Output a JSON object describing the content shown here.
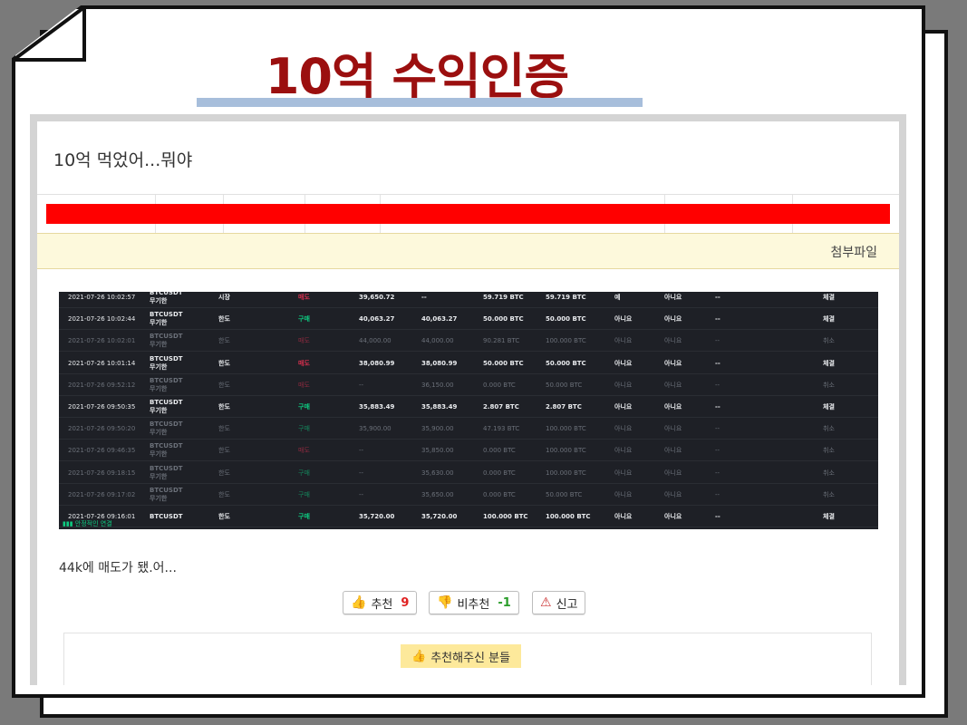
{
  "headline": {
    "text": "10억 수익인증",
    "color": "#9b0f0f",
    "underline_color": "#a7bedb"
  },
  "post": {
    "title": "10억 먹었어...뭐야",
    "redacted_bar_color": "#ff0000",
    "attachment_label": "첨부파일",
    "attachment_bar_color": "#fdf9dc",
    "body": "44k에 매도가 됐.어..."
  },
  "trade_screenshot": {
    "connection_status": "안정적인 연결",
    "rows": [
      {
        "time": "2021-07-26 10:02:57",
        "symbol": "BTCUSDT",
        "contract": "무기한",
        "type": "시장",
        "side": "매도",
        "price": "39,650.72",
        "avg": "--",
        "filled": "59.719 BTC",
        "amount": "59.719 BTC",
        "reduce": "예",
        "post": "아니요",
        "trigger": "--",
        "status": "체결",
        "active": true
      },
      {
        "time": "2021-07-26 10:02:44",
        "symbol": "BTCUSDT",
        "contract": "무기한",
        "type": "한도",
        "side": "구매",
        "price": "40,063.27",
        "avg": "40,063.27",
        "filled": "50.000 BTC",
        "amount": "50.000 BTC",
        "reduce": "아니요",
        "post": "아니요",
        "trigger": "--",
        "status": "체결",
        "active": true
      },
      {
        "time": "2021-07-26 10:02:01",
        "symbol": "BTCUSDT",
        "contract": "무기한",
        "type": "한도",
        "side": "매도",
        "price": "44,000.00",
        "avg": "44,000.00",
        "filled": "90.281 BTC",
        "amount": "100.000 BTC",
        "reduce": "아니요",
        "post": "아니요",
        "trigger": "--",
        "status": "취소",
        "active": false
      },
      {
        "time": "2021-07-26 10:01:14",
        "symbol": "BTCUSDT",
        "contract": "무기한",
        "type": "한도",
        "side": "매도",
        "price": "38,080.99",
        "avg": "38,080.99",
        "filled": "50.000 BTC",
        "amount": "50.000 BTC",
        "reduce": "아니요",
        "post": "아니요",
        "trigger": "--",
        "status": "체결",
        "active": true
      },
      {
        "time": "2021-07-26 09:52:12",
        "symbol": "BTCUSDT",
        "contract": "무기한",
        "type": "한도",
        "side": "매도",
        "price": "--",
        "avg": "36,150.00",
        "filled": "0.000 BTC",
        "amount": "50.000 BTC",
        "reduce": "아니요",
        "post": "아니요",
        "trigger": "--",
        "status": "취소",
        "active": false
      },
      {
        "time": "2021-07-26 09:50:35",
        "symbol": "BTCUSDT",
        "contract": "무기한",
        "type": "한도",
        "side": "구매",
        "price": "35,883.49",
        "avg": "35,883.49",
        "filled": "2.807 BTC",
        "amount": "2.807 BTC",
        "reduce": "아니요",
        "post": "아니요",
        "trigger": "--",
        "status": "체결",
        "active": true
      },
      {
        "time": "2021-07-26 09:50:20",
        "symbol": "BTCUSDT",
        "contract": "무기한",
        "type": "한도",
        "side": "구매",
        "price": "35,900.00",
        "avg": "35,900.00",
        "filled": "47.193 BTC",
        "amount": "100.000 BTC",
        "reduce": "아니요",
        "post": "아니요",
        "trigger": "--",
        "status": "취소",
        "active": false
      },
      {
        "time": "2021-07-26 09:46:35",
        "symbol": "BTCUSDT",
        "contract": "무기한",
        "type": "한도",
        "side": "매도",
        "price": "--",
        "avg": "35,850.00",
        "filled": "0.000 BTC",
        "amount": "100.000 BTC",
        "reduce": "아니요",
        "post": "아니요",
        "trigger": "--",
        "status": "취소",
        "active": false
      },
      {
        "time": "2021-07-26 09:18:15",
        "symbol": "BTCUSDT",
        "contract": "무기한",
        "type": "한도",
        "side": "구매",
        "price": "--",
        "avg": "35,630.00",
        "filled": "0.000 BTC",
        "amount": "100.000 BTC",
        "reduce": "아니요",
        "post": "아니요",
        "trigger": "--",
        "status": "취소",
        "active": false
      },
      {
        "time": "2021-07-26 09:17:02",
        "symbol": "BTCUSDT",
        "contract": "무기한",
        "type": "한도",
        "side": "구매",
        "price": "--",
        "avg": "35,650.00",
        "filled": "0.000 BTC",
        "amount": "50.000 BTC",
        "reduce": "아니요",
        "post": "아니요",
        "trigger": "--",
        "status": "취소",
        "active": false
      },
      {
        "time": "2021-07-26 09:16:01",
        "symbol": "BTCUSDT",
        "contract": "",
        "type": "한도",
        "side": "구매",
        "price": "35,720.00",
        "avg": "35,720.00",
        "filled": "100.000 BTC",
        "amount": "100.000 BTC",
        "reduce": "아니요",
        "post": "아니요",
        "trigger": "--",
        "status": "체결",
        "active": true
      }
    ],
    "colors": {
      "sell": "#d9304f",
      "buy": "#0ecb81",
      "active_text": "#eaecef",
      "inactive_text": "#6b7079",
      "connected": "#0ecb81"
    }
  },
  "actions": {
    "recommend": {
      "label": "추천",
      "count": "9",
      "count_color": "#e02020"
    },
    "not_recommend": {
      "label": "비추천",
      "count": "-1",
      "count_color": "#2a9d2a"
    },
    "report": {
      "label": "신고"
    }
  },
  "recommenders": {
    "label": "추천해주신 분들"
  }
}
